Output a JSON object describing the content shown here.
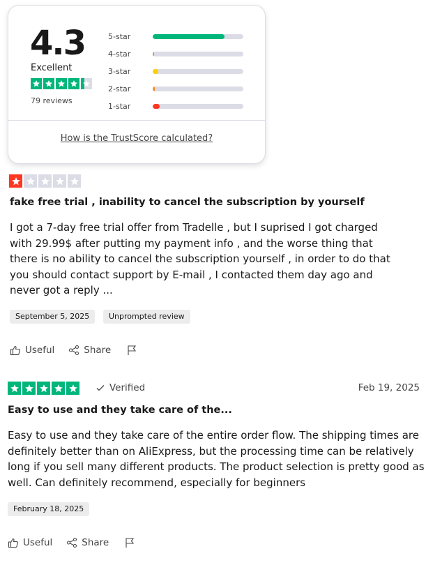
{
  "summary": {
    "score": "4.3",
    "rating_word": "Excellent",
    "review_count": "79 reviews",
    "stars_filled_fraction": 0.86,
    "link_text": "How is the TrustScore calculated?",
    "distribution": [
      {
        "label": "5-star",
        "fraction": 0.79,
        "color": "#00b67a"
      },
      {
        "label": "4-star",
        "fraction": 0.01,
        "color": "#73cf11"
      },
      {
        "label": "3-star",
        "fraction": 0.06,
        "color": "#ffce00"
      },
      {
        "label": "2-star",
        "fraction": 0.02,
        "color": "#ff8622"
      },
      {
        "label": "1-star",
        "fraction": 0.08,
        "color": "#ff3722"
      }
    ]
  },
  "reviews": [
    {
      "rating": 1,
      "rating_color": "#ff3722",
      "title": "fake free trial , inability to cancel the subscription by yourself",
      "lines": [
        "I got a 7-day free trial offer from Tradelle , but I suprised I got charged",
        "with 29.99$ after putting my payment info , and the worse thing that",
        "there is no ability to cancel the subscription yourself , in order to do that",
        "you should contact support by E-mail , I contacted them day ago and",
        "never got a reply ..."
      ],
      "date_tag": "September 5, 2025",
      "extra_tag": "Unprompted review",
      "useful": "Useful",
      "share": "Share"
    },
    {
      "rating": 5,
      "rating_color": "#00b67a",
      "verified": "Verified",
      "date": "Feb 19, 2025",
      "title": "Easy to use and they take care of the...",
      "lines": [
        "Easy to use and they take care of the entire order flow. The shipping times are",
        "definitely better than on AliExpress, but the processing time can be relatively",
        "long if you sell many different products. The product selection is pretty good as",
        "well. Can definitely recommend, especially for beginners"
      ],
      "date_tag": "February 18, 2025",
      "useful": "Useful",
      "share": "Share"
    }
  ]
}
